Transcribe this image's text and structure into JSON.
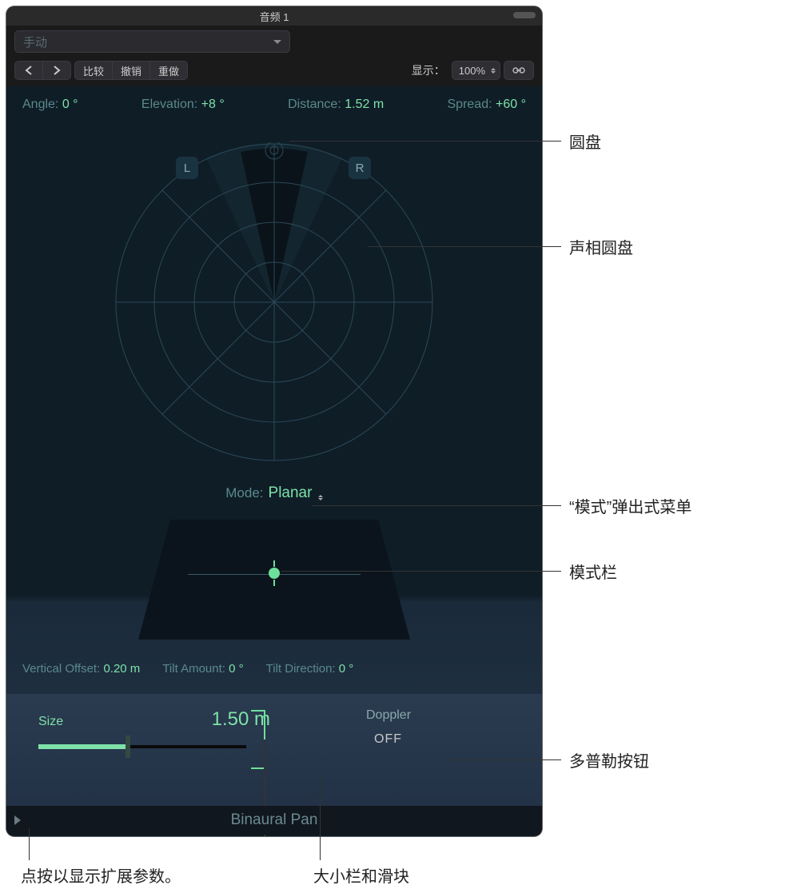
{
  "titlebar": {
    "title": "音频 1"
  },
  "preset": {
    "placeholder": "手动"
  },
  "toolbar": {
    "compare": "比较",
    "undo": "撤销",
    "redo": "重做",
    "show_label": "显示：",
    "zoom": "100%"
  },
  "params": {
    "angle_label": "Angle:",
    "angle_value": "0 °",
    "elevation_label": "Elevation:",
    "elevation_value": "+8 °",
    "distance_label": "Distance:",
    "distance_value": "1.52 m",
    "spread_label": "Spread:",
    "spread_value": "+60 °"
  },
  "lr": {
    "l": "L",
    "r": "R"
  },
  "mode": {
    "label": "Mode:",
    "value": "Planar"
  },
  "tilt": {
    "voffset_label": "Vertical Offset:",
    "voffset_value": "0.20 m",
    "tamount_label": "Tilt Amount:",
    "tamount_value": "0 °",
    "tdir_label": "Tilt Direction:",
    "tdir_value": "0 °"
  },
  "size": {
    "label": "Size",
    "value": "1.50 m"
  },
  "doppler": {
    "label": "Doppler",
    "value": "OFF"
  },
  "footer": {
    "title": "Binaural Pan"
  },
  "callouts": {
    "puck": "圆盘",
    "panpuck": "声相圆盘",
    "mode_popup": "“模式”弹出式菜单",
    "mode_col": "模式栏",
    "doppler_btn": "多普勒按钮",
    "disclosure_hint": "点按以显示扩展参数。",
    "size_field": "大小栏和滑块"
  }
}
